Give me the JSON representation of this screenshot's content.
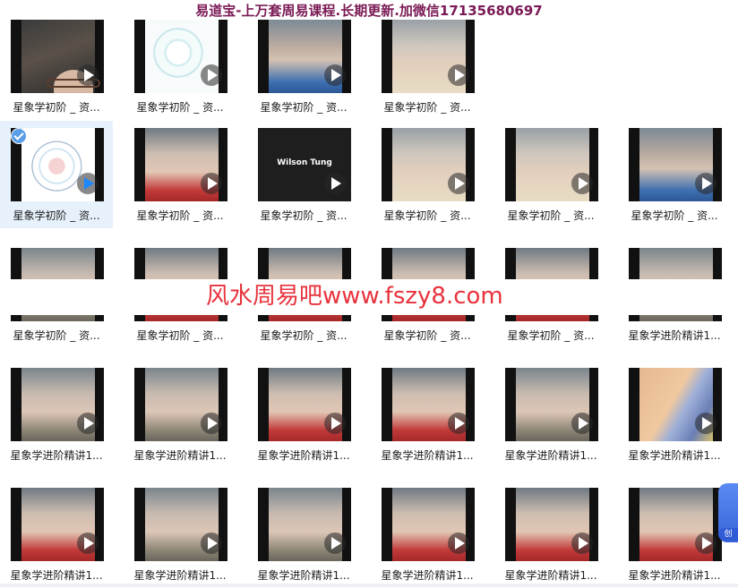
{
  "banner": {
    "text": "易道宝-上万套周易课程.长期更新.加微信17135680697",
    "color": "#7a1a55"
  },
  "watermark": {
    "text": "风水周易吧www.fszy8.com",
    "color": "#e8323c"
  },
  "side_button": {
    "label": "创",
    "color": "#3a63d8"
  },
  "rows": [
    {
      "tiles": [
        {
          "label": "星象学初阶 _ 资...",
          "thumb": "woman-glasses"
        },
        {
          "label": "星象学初阶 _ 资...",
          "thumb": "astro-chart-light"
        },
        {
          "label": "星象学初阶 _ 资...",
          "thumb": "old-man-blue"
        },
        {
          "label": "星象学初阶 _ 资...",
          "thumb": "old-man-cream"
        }
      ]
    },
    {
      "tiles": [
        {
          "label": "星象学初阶 _ 资...",
          "thumb": "astro-chart",
          "selected": true
        },
        {
          "label": "星象学初阶 _ 资...",
          "thumb": "old-man-red"
        },
        {
          "label": "星象学初阶 _ 资...",
          "thumb": "title-card",
          "title_text": "Wilson Tung"
        },
        {
          "label": "星象学初阶 _ 资...",
          "thumb": "old-man-cream"
        },
        {
          "label": "星象学初阶 _ 资...",
          "thumb": "old-man-cream"
        },
        {
          "label": "星象学初阶 _ 资...",
          "thumb": "old-man-blue"
        }
      ]
    },
    {
      "tiles": [
        {
          "label": "星象学初阶 _ 资...",
          "thumb": "old-man-grey"
        },
        {
          "label": "星象学初阶 _ 资...",
          "thumb": "old-man-red"
        },
        {
          "label": "星象学初阶 _ 资...",
          "thumb": "old-man-red"
        },
        {
          "label": "星象学初阶 _ 资...",
          "thumb": "old-man-red"
        },
        {
          "label": "星象学初阶 _ 资...",
          "thumb": "old-man-red"
        },
        {
          "label": "星象学进阶精讲1...",
          "thumb": "old-man-grey"
        }
      ]
    },
    {
      "tiles": [
        {
          "label": "星象学进阶精讲1...",
          "thumb": "old-man-grey"
        },
        {
          "label": "星象学进阶精讲1...",
          "thumb": "old-man-grey"
        },
        {
          "label": "星象学进阶精讲1...",
          "thumb": "old-man-red"
        },
        {
          "label": "星象学进阶精讲1...",
          "thumb": "old-man-red"
        },
        {
          "label": "星象学进阶精讲1...",
          "thumb": "old-man-grey"
        },
        {
          "label": "星象学进阶精讲1...",
          "thumb": "child-crystal"
        }
      ]
    },
    {
      "tiles": [
        {
          "label": "星象学进阶精讲1...",
          "thumb": "old-man-red"
        },
        {
          "label": "星象学进阶精讲1...",
          "thumb": "old-man-grey"
        },
        {
          "label": "星象学进阶精讲1...",
          "thumb": "old-man-grey"
        },
        {
          "label": "星象学进阶精讲1...",
          "thumb": "old-man-red"
        },
        {
          "label": "星象学进阶精讲1...",
          "thumb": "old-man-red"
        },
        {
          "label": "星象学进阶精讲1...",
          "thumb": "old-man-red"
        }
      ]
    }
  ]
}
